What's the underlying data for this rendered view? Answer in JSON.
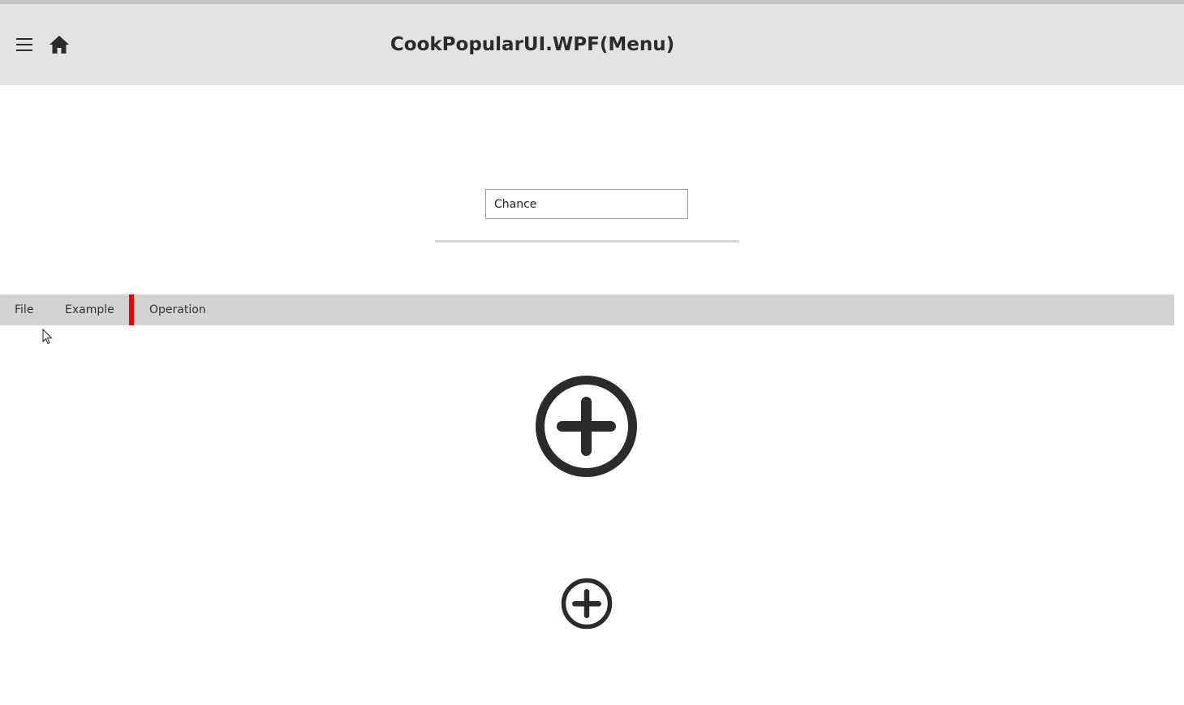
{
  "header": {
    "title": "CookPopularUI.WPF(Menu)",
    "menu_icon": "hamburger-icon",
    "home_icon": "home-icon"
  },
  "search": {
    "value": "Chance"
  },
  "menu": {
    "items": [
      {
        "label": "File"
      },
      {
        "label": "Example"
      },
      {
        "label": "Operation"
      }
    ],
    "separator_color": "#ee0000"
  },
  "icons": {
    "large": "add-circle-icon",
    "small": "add-circle-icon"
  },
  "colors": {
    "header_bg": "#e3e3e3",
    "menubar_bg": "#d3d3d3",
    "icon": "#2b2b2b"
  }
}
